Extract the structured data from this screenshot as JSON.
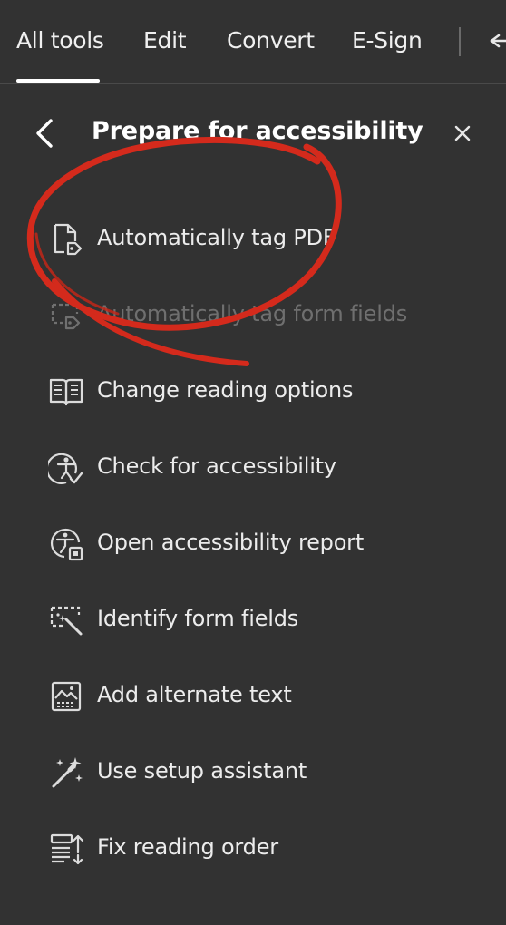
{
  "tabs": [
    {
      "label": "All tools",
      "active": true
    },
    {
      "label": "Edit",
      "active": false
    },
    {
      "label": "Convert",
      "active": false
    },
    {
      "label": "E-Sign",
      "active": false
    }
  ],
  "toolbar": {
    "undo_icon": "undo-arrow-icon"
  },
  "panel": {
    "title": "Prepare for accessibility",
    "back_icon": "chevron-left-icon",
    "close_icon": "close-icon"
  },
  "tools": [
    {
      "label": "Automatically tag PDF",
      "icon": "tag-document-icon",
      "enabled": true
    },
    {
      "label": "Automatically tag form fields",
      "icon": "tag-form-fields-icon",
      "enabled": false
    },
    {
      "label": "Change reading options",
      "icon": "open-book-icon",
      "enabled": true
    },
    {
      "label": "Check for accessibility",
      "icon": "accessibility-check-icon",
      "enabled": true
    },
    {
      "label": "Open accessibility report",
      "icon": "accessibility-report-icon",
      "enabled": true
    },
    {
      "label": "Identify form fields",
      "icon": "form-field-wand-icon",
      "enabled": true
    },
    {
      "label": "Add alternate text",
      "icon": "image-alt-text-icon",
      "enabled": true
    },
    {
      "label": "Use setup assistant",
      "icon": "magic-wand-icon",
      "enabled": true
    },
    {
      "label": "Fix reading order",
      "icon": "reading-order-icon",
      "enabled": true
    }
  ],
  "colors": {
    "background": "#323232",
    "text": "#ececec",
    "disabled_text": "#6f6f6f",
    "annotation": "#d42a1c"
  }
}
